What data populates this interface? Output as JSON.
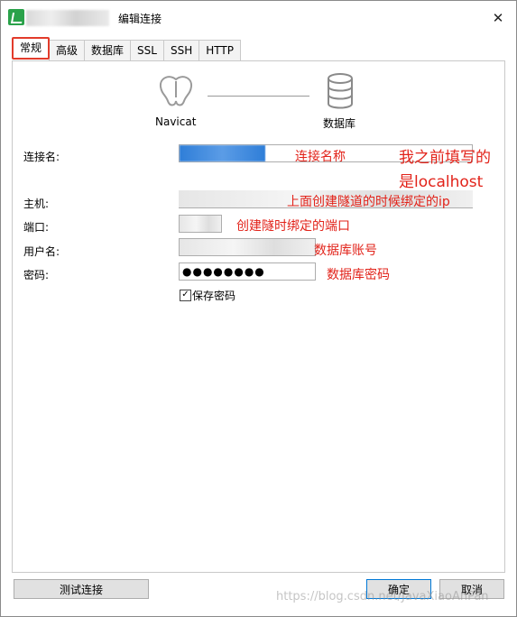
{
  "window": {
    "title": "编辑连接",
    "close_symbol": "✕"
  },
  "tabs": [
    "常规",
    "高级",
    "数据库",
    "SSL",
    "SSH",
    "HTTP"
  ],
  "header": {
    "left_label": "Navicat",
    "right_label": "数据库"
  },
  "form": {
    "connection_name_label": "连接名:",
    "host_label": "主机:",
    "port_label": "端口:",
    "username_label": "用户名:",
    "password_label": "密码:",
    "password_value": "●●●●●●●●",
    "save_password_label": "保存密码"
  },
  "annotations": {
    "connection_name": "连接名称",
    "note_line1": "我之前填写的",
    "note_line2": "是localhost",
    "host": "上面创建隧道的时候绑定的ip",
    "port": "创建隧时绑定的端口",
    "username": "数据库账号",
    "password": "数据库密码"
  },
  "buttons": {
    "test": "测试连接",
    "ok": "确定",
    "cancel": "取消"
  },
  "watermark": "https://blog.csdn.net/JavaXiaoAnPan",
  "colors": {
    "annotation": "#e2231a",
    "highlight": "#2f7ed8"
  }
}
